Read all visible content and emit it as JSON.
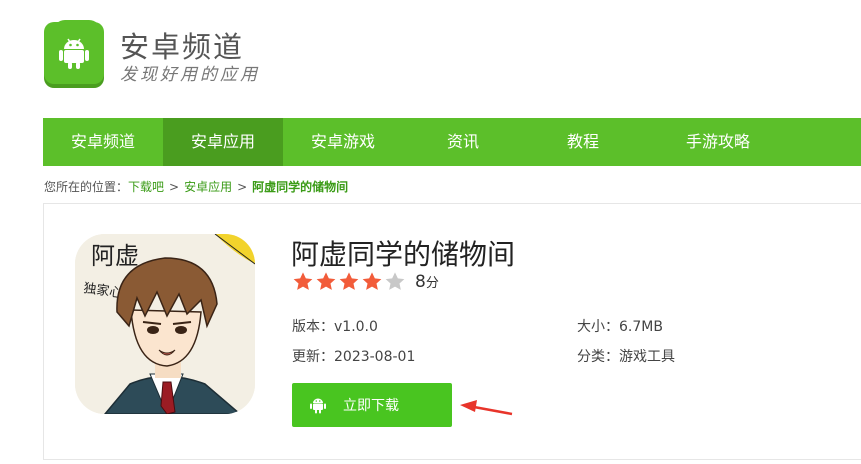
{
  "header": {
    "site_title": "安卓频道",
    "slogan": "发现好用的应用",
    "logo_icon": "android-bag-icon",
    "brand_color": "#5cbf2a"
  },
  "nav": {
    "items": [
      {
        "label": "安卓频道",
        "active": false
      },
      {
        "label": "安卓应用",
        "active": true
      },
      {
        "label": "安卓游戏",
        "active": false
      },
      {
        "label": "资讯",
        "active": false
      },
      {
        "label": "教程",
        "active": false
      },
      {
        "label": "手游攻略",
        "active": false
      }
    ]
  },
  "breadcrumb": {
    "prefix": "您所在的位置：",
    "items": [
      "下载吧",
      "安卓应用"
    ],
    "current": "阿虚同学的储物间",
    "separator": ">"
  },
  "app": {
    "name": "阿虚同学的储物间",
    "icon": "anime-character-app-icon",
    "icon_text": "阿虚",
    "icon_subtext": "独家心得",
    "stars_filled": 4,
    "stars_total": 5,
    "score": "8",
    "score_unit": "分",
    "version_label": "版本：",
    "version": "v1.0.0",
    "updated_label": "更新：",
    "updated": "2023-08-01",
    "size_label": "大小：",
    "size": "6.7MB",
    "category_label": "分类：",
    "category": "游戏工具",
    "download_label": "立即下载",
    "download_icon": "android-icon",
    "star_color": "#f25c3a",
    "button_color": "#49c520",
    "arrow_color": "#e8342a"
  }
}
